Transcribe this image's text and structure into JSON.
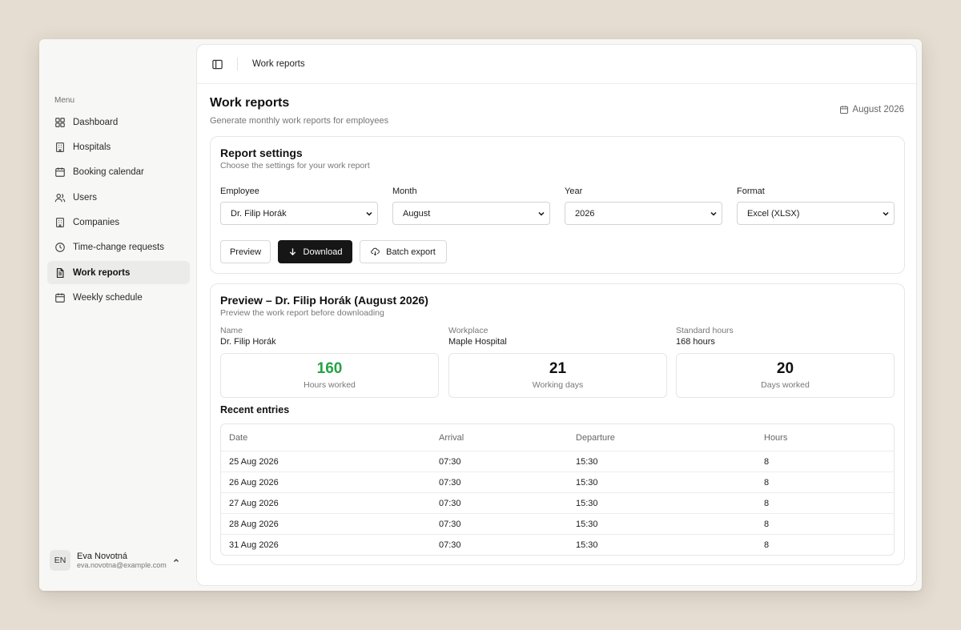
{
  "sidebar": {
    "caption": "Menu",
    "items": [
      {
        "label": "Dashboard",
        "icon": "grid-icon"
      },
      {
        "label": "Hospitals",
        "icon": "building-icon"
      },
      {
        "label": "Booking calendar",
        "icon": "calendar-icon"
      },
      {
        "label": "Users",
        "icon": "users-icon"
      },
      {
        "label": "Companies",
        "icon": "building-icon"
      },
      {
        "label": "Time-change requests",
        "icon": "clock-icon"
      },
      {
        "label": "Work reports",
        "icon": "document-icon",
        "active": true
      },
      {
        "label": "Weekly schedule",
        "icon": "calendar-icon"
      }
    ],
    "user": {
      "initials": "EN",
      "name": "Eva Novotná",
      "email": "eva.novotna@example.com"
    }
  },
  "topbar": {
    "breadcrumb": "Work reports"
  },
  "page": {
    "title": "Work reports",
    "subtitle": "Generate monthly work reports for employees",
    "period": "August 2026"
  },
  "settings": {
    "title": "Report settings",
    "subtitle": "Choose the settings for your work report",
    "fields": {
      "employee": {
        "label": "Employee",
        "value": "Dr. Filip Horák"
      },
      "month": {
        "label": "Month",
        "value": "August"
      },
      "year": {
        "label": "Year",
        "value": "2026"
      },
      "format": {
        "label": "Format",
        "value": "Excel (XLSX)"
      }
    },
    "buttons": {
      "preview": "Preview",
      "download": "Download",
      "batch": "Batch export"
    }
  },
  "preview": {
    "title": "Preview – Dr. Filip Horák (August 2026)",
    "subtitle": "Preview the work report before downloading",
    "info": {
      "name": {
        "label": "Name",
        "value": "Dr. Filip Horák"
      },
      "workplace": {
        "label": "Workplace",
        "value": "Maple Hospital"
      },
      "standard": {
        "label": "Standard hours",
        "value": "168 hours"
      }
    },
    "stats": {
      "hours": {
        "value": "160",
        "label": "Hours worked"
      },
      "working_days": {
        "value": "21",
        "label": "Working days"
      },
      "days_worked": {
        "value": "20",
        "label": "Days worked"
      }
    },
    "recent_title": "Recent entries",
    "table": {
      "headers": [
        "Date",
        "Arrival",
        "Departure",
        "Hours"
      ],
      "rows": [
        [
          "25 Aug 2026",
          "07:30",
          "15:30",
          "8"
        ],
        [
          "26 Aug 2026",
          "07:30",
          "15:30",
          "8"
        ],
        [
          "27 Aug 2026",
          "07:30",
          "15:30",
          "8"
        ],
        [
          "28 Aug 2026",
          "07:30",
          "15:30",
          "8"
        ],
        [
          "31 Aug 2026",
          "07:30",
          "15:30",
          "8"
        ]
      ]
    }
  },
  "colors": {
    "accent_green": "#25a244",
    "primary_button": "#161616",
    "background": "#e5ddd1"
  }
}
